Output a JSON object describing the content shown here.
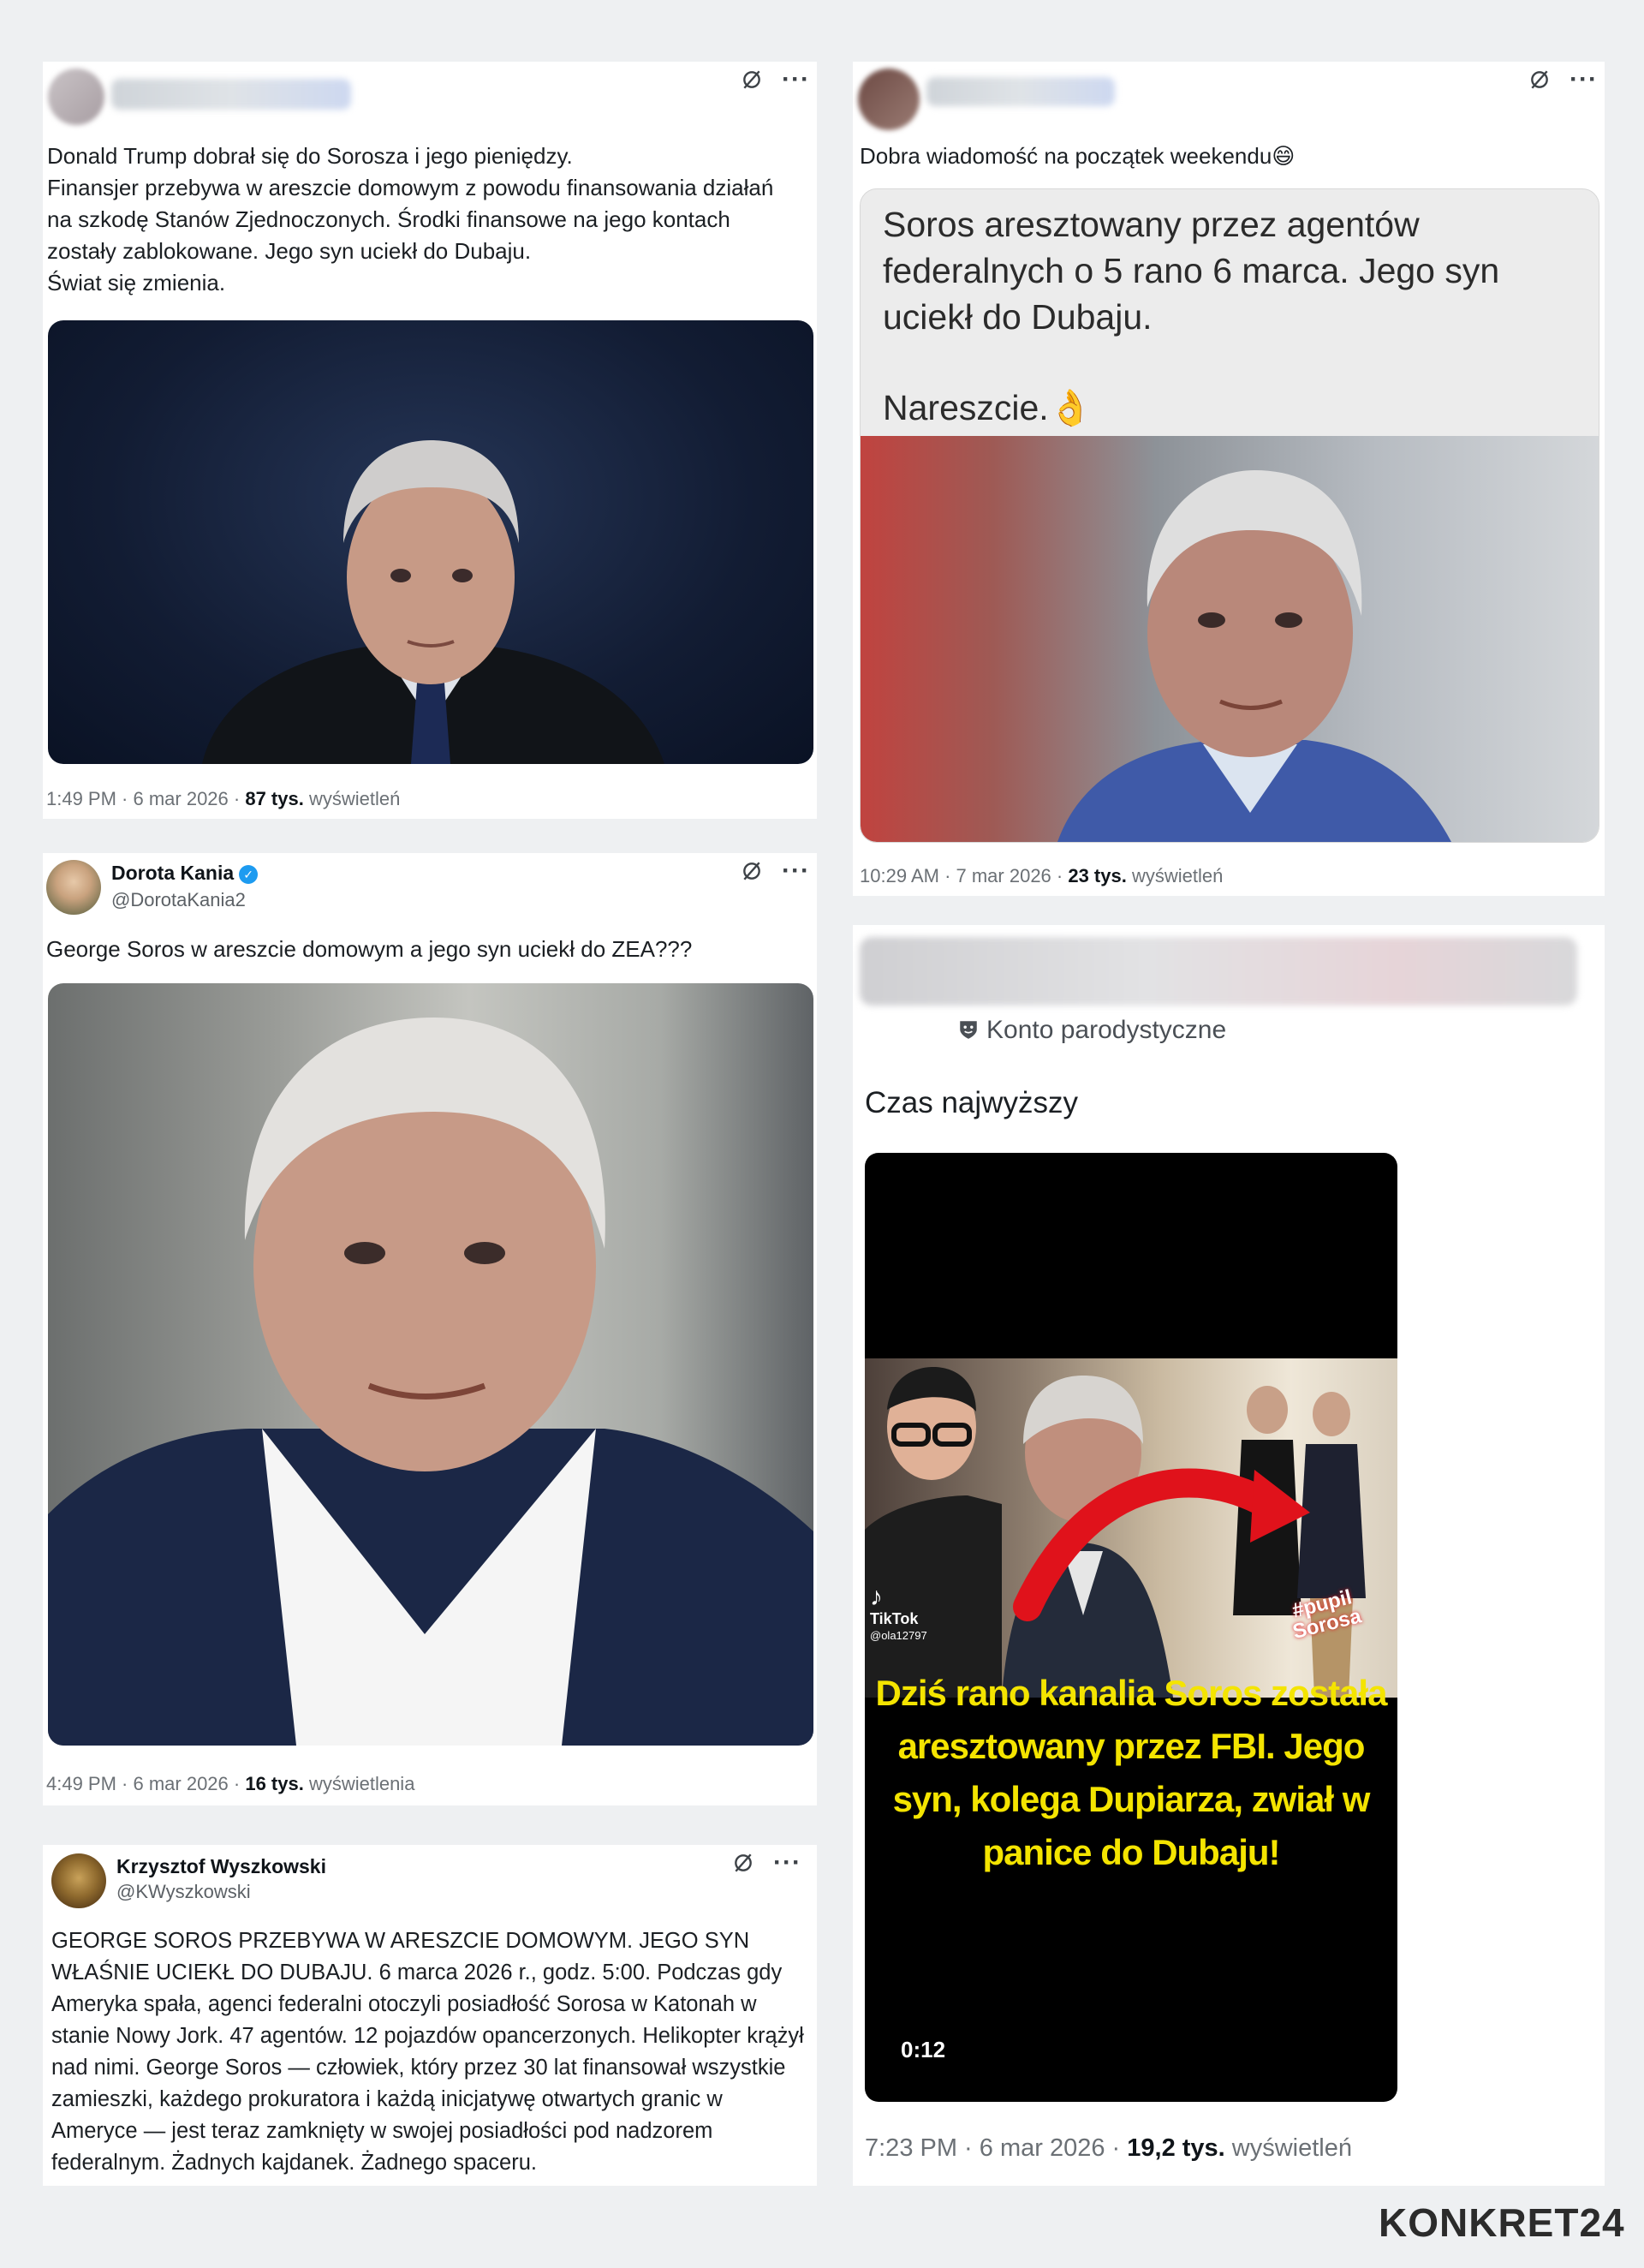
{
  "tweet1": {
    "text": "Donald Trump dobrał się do Sorosza i jego pieniędzy.\nFinansjer przebywa w areszcie domowym z powodu finansowania działań na szkodę Stanów Zjednoczonych. Środki finansowe na jego kontach zostały zablokowane. Jego syn uciekł do Dubaju.\nŚwiat się zmienia.",
    "time": "1:49 PM · 6 mar 2026 · ",
    "views": "87 tys.",
    "views_label": " wyświetleń"
  },
  "tweet2": {
    "text": "Dobra wiadomość na początek weekendu",
    "emoji": "😄",
    "card_text": "Soros aresztowany przez agentów federalnych o 5 rano 6 marca. Jego syn uciekł do Dubaju.",
    "card_text2": "Nareszcie.",
    "card_emoji": "👌",
    "time": "10:29 AM · 7 mar 2026 · ",
    "views": "23 tys.",
    "views_label": " wyświetleń"
  },
  "tweet3": {
    "name": "Dorota Kania",
    "handle": "@DorotaKania2",
    "text": "George Soros w areszcie domowym a jego syn uciekł do ZEA???",
    "time": "4:49 PM · 6 mar 2026 · ",
    "views": "16 tys.",
    "views_label": " wyświetlenia"
  },
  "tweet4": {
    "parody_label": "Konto parodystyczne",
    "text": "Czas najwyższy",
    "video": {
      "tiktok": "TikTok",
      "tiktok_user": "@ola12797",
      "hashtag": "#pupil Sorosa",
      "caption": "Dziś rano kanalia Soros została aresztowany przez FBI. Jego syn, kolega Dupiarza, zwiał w panice do Dubaju!",
      "duration": "0:12"
    },
    "time": "7:23 PM · 6 mar 2026 · ",
    "views": "19,2 tys.",
    "views_label": " wyświetleń"
  },
  "tweet5": {
    "name": "Krzysztof Wyszkowski",
    "handle": "@KWyszkowski",
    "text": "GEORGE SOROS PRZEBYWA W ARESZCIE DOMOWYM. JEGO SYN WŁAŚNIE UCIEKŁ DO DUBAJU.  6 marca 2026 r., godz. 5:00.  Podczas gdy Ameryka spała, agenci federalni otoczyli posiadłość Sorosa w Katonah w stanie Nowy Jork. 47 agentów. 12 pojazdów opancerzonych. Helikopter krążył nad nimi.  George Soros — człowiek, który przez 30 lat finansował wszystkie zamieszki, każdego prokuratora i każdą inicjatywę otwartych granic w Ameryce — jest teraz zamknięty w swojej posiadłości pod nadzorem federalnym.  Żadnych kajdanek. Żadnego spaceru."
  },
  "brand": {
    "logo": "KONKRET24"
  },
  "colors": {
    "verified": "#1d9bf0",
    "caption_yellow": "#f4e400",
    "arrow_red": "#e0121b"
  }
}
